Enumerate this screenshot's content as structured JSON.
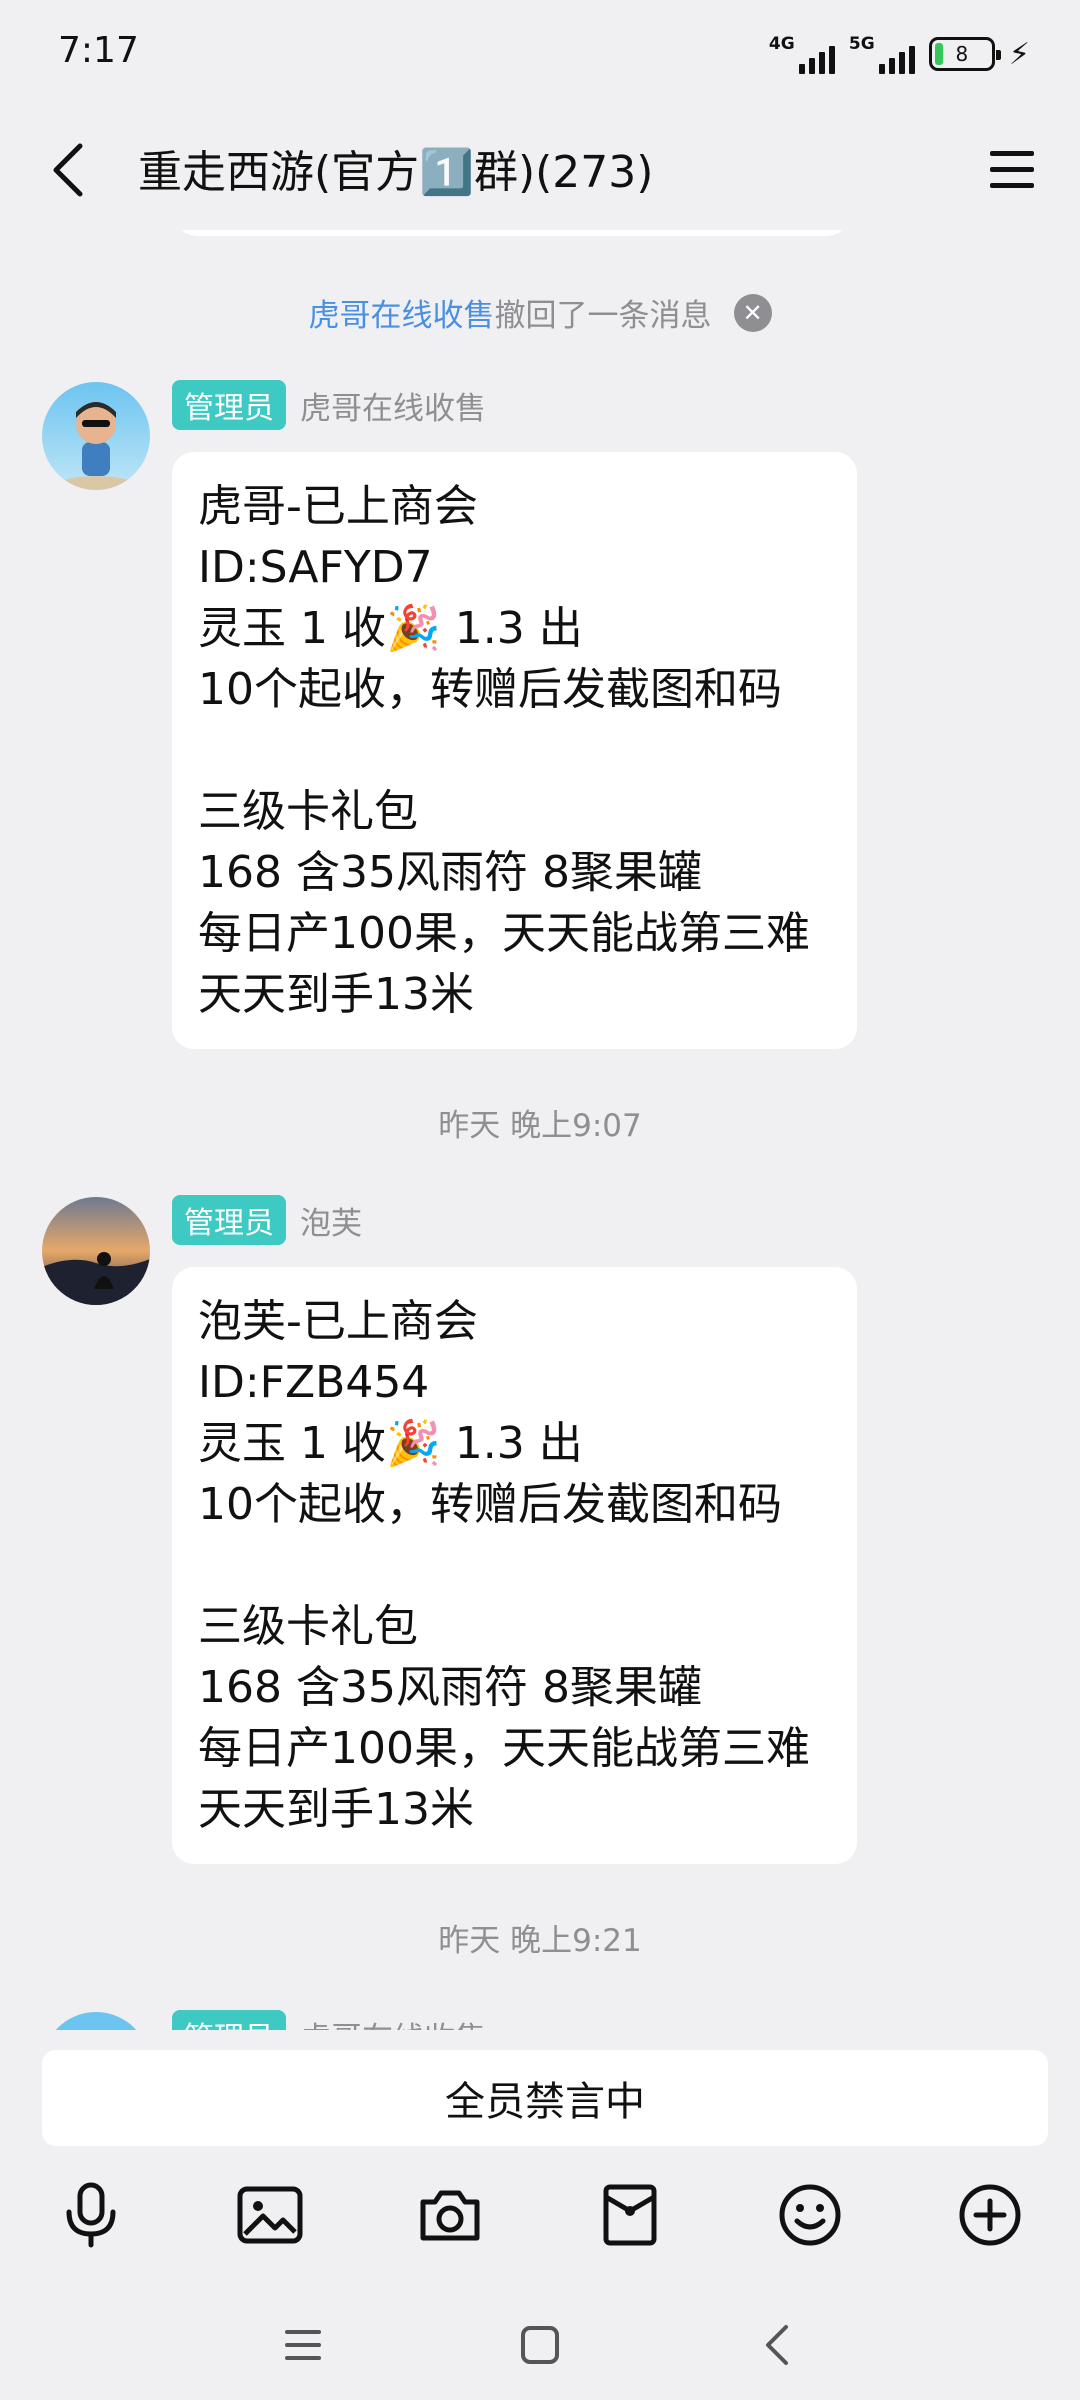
{
  "status_bar": {
    "time": "7:17",
    "network_1": "4G",
    "network_2": "5G",
    "battery": "8"
  },
  "header": {
    "title": "重走西游(官方1️⃣群)(273)"
  },
  "recall_notice": {
    "who": "虎哥在线收售",
    "text": "撤回了一条消息"
  },
  "messages": [
    {
      "role": "管理员",
      "sender": "虎哥在线收售",
      "lines": [
        "虎哥-已上商会",
        "ID:SAFYD7",
        "灵玉 1 收🎉 1.3 出",
        "10个起收，转赠后发截图和码",
        "",
        "三级卡礼包",
        "168 含35风雨符 8聚果罐",
        "每日产100果，天天能战第三难",
        "天天到手13米"
      ]
    },
    {
      "role": "管理员",
      "sender": "泡芙",
      "lines": [
        "泡芙-已上商会",
        "ID:FZB454",
        "灵玉 1 收🎉 1.3 出",
        "10个起收，转赠后发截图和码",
        "",
        "三级卡礼包",
        "168 含35风雨符 8聚果罐",
        "每日产100果，天天能战第三难",
        "天天到手13米"
      ]
    },
    {
      "role": "管理员",
      "sender": "虎哥在线收售"
    }
  ],
  "timestamps": [
    "昨天 晚上9:07",
    "昨天 晚上9:21"
  ],
  "mute_notice": "全员禁言中",
  "toolbar": {
    "icons": [
      "microphone-icon",
      "image-icon",
      "camera-icon",
      "red-packet-icon",
      "emoji-icon",
      "plus-icon"
    ]
  },
  "system_nav": [
    "menu",
    "home",
    "back"
  ],
  "colors": {
    "background": "#f0f0f2",
    "role_badge": "#3ec9c2",
    "link_blue": "#4a90e2",
    "muted_text": "#8e8e93"
  }
}
